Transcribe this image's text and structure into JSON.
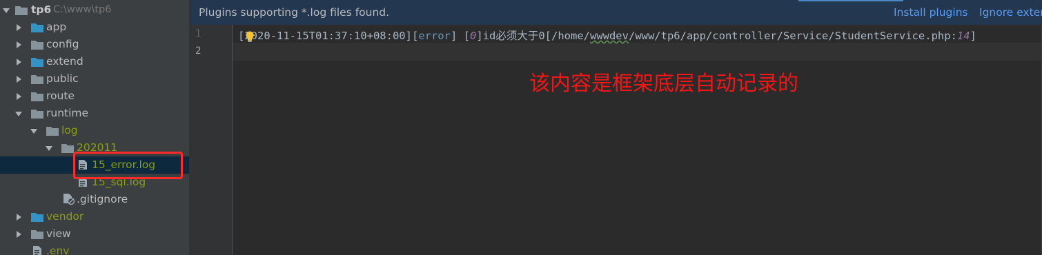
{
  "project": {
    "name": "tp6",
    "path": "C:\\www\\tp6"
  },
  "tree": [
    {
      "label": "app",
      "kind": "folder",
      "state": "collapsed",
      "color": "normal"
    },
    {
      "label": "config",
      "kind": "folder",
      "state": "collapsed",
      "color": "normal"
    },
    {
      "label": "extend",
      "kind": "folder",
      "state": "collapsed",
      "color": "normal"
    },
    {
      "label": "public",
      "kind": "folder",
      "state": "collapsed",
      "color": "normal"
    },
    {
      "label": "route",
      "kind": "folder",
      "state": "collapsed",
      "color": "normal"
    },
    {
      "label": "runtime",
      "kind": "folder",
      "state": "expanded",
      "color": "normal"
    },
    {
      "label": "log",
      "kind": "folder",
      "state": "expanded",
      "color": "yellow"
    },
    {
      "label": "202011",
      "kind": "folder",
      "state": "expanded",
      "color": "yellow"
    },
    {
      "label": "15_error.log",
      "kind": "file",
      "color": "yellow",
      "selected": true
    },
    {
      "label": "15_sql.log",
      "kind": "file",
      "color": "yellow"
    },
    {
      "label": ".gitignore",
      "kind": "file-ignore",
      "color": "normal"
    },
    {
      "label": "vendor",
      "kind": "folder",
      "state": "collapsed",
      "color": "yellow"
    },
    {
      "label": "view",
      "kind": "folder",
      "state": "collapsed",
      "color": "normal"
    },
    {
      "label": ".env",
      "kind": "file",
      "color": "yellow"
    }
  ],
  "banner": {
    "message": "Plugins supporting *.log files found.",
    "install_link": "Install plugins",
    "ignore_link": "Ignore extensions"
  },
  "editor": {
    "line_numbers": [
      "1",
      "2"
    ],
    "line1": {
      "open": "[",
      "timestamp": "2020-11-15T01:37:10+08:00",
      "mid": "][",
      "level": "error",
      "sep": "] [",
      "code": "0",
      "msg_pre": "]id必须大于0[/home/",
      "msg_wavy": "wwwdev",
      "msg_post": "/www/tp6/app/controller/Service/StudentService.php:",
      "line_no": "14",
      "close": "]"
    }
  },
  "annotation": "该内容是框架底层自动记录的",
  "colors": {
    "sidebar_bg": "#3c3f41",
    "editor_bg": "#2b2b2b",
    "banner_bg": "#243750",
    "selection_bg": "#0d293e",
    "annotation_red": "#f21616",
    "link_blue": "#589df6",
    "ignored_file_olive": "#8b9c15"
  }
}
